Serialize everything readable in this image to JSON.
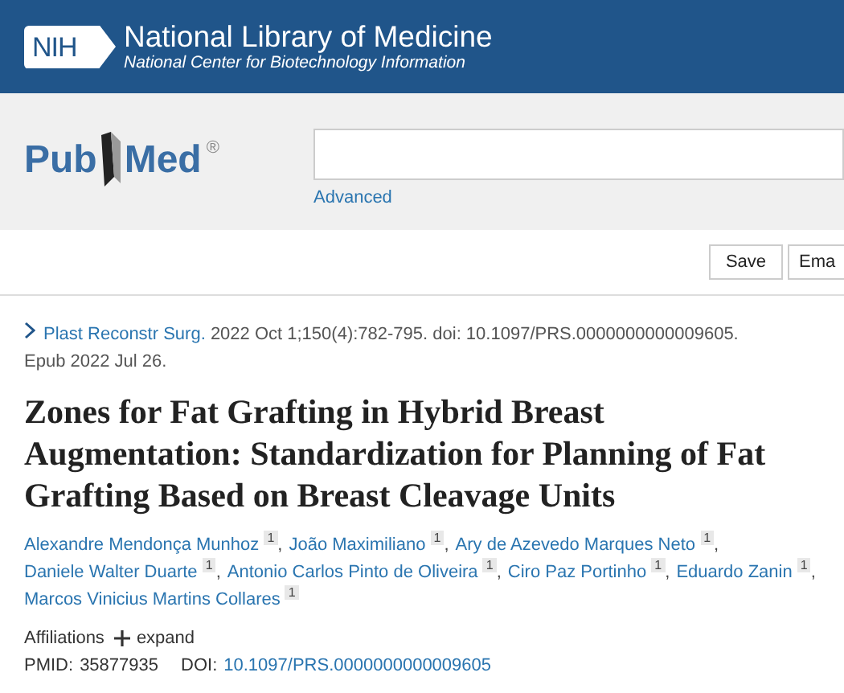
{
  "header": {
    "badge": "NIH",
    "title": "National Library of Medicine",
    "subtitle": "National Center for Biotechnology Information"
  },
  "search": {
    "logo": {
      "left": "Pub",
      "right": "Med",
      "mark": "®"
    },
    "advanced": "Advanced"
  },
  "toolbar": {
    "buttons": [
      "Save",
      "Ema"
    ]
  },
  "citation": {
    "journal": "Plast Reconstr Surg.",
    "details": "2022 Oct 1;150(4):782-795. doi: 10.1097/PRS.0000000000009605.",
    "epub": "Epub 2022 Jul 26."
  },
  "title": "Zones for Fat Grafting in Hybrid Breast Augmentation: Standardization for Planning of Fat Grafting Based on Breast Cleavage Units",
  "author_separator": ",",
  "authors": [
    {
      "name": "Alexandre Mendonça Munhoz",
      "ref": "1"
    },
    {
      "name": "João Maximiliano",
      "ref": "1"
    },
    {
      "name": "Ary de Azevedo Marques Neto",
      "ref": "1"
    },
    {
      "name": "Daniele Walter Duarte",
      "ref": "1"
    },
    {
      "name": "Antonio Carlos Pinto de Oliveira",
      "ref": "1"
    },
    {
      "name": "Ciro Paz Portinho",
      "ref": "1"
    },
    {
      "name": "Eduardo Zanin",
      "ref": "1"
    },
    {
      "name": "Marcos Vinicius Martins Collares",
      "ref": "1"
    }
  ],
  "affiliations": {
    "label": "Affiliations",
    "toggle": "expand",
    "expanded": false
  },
  "ids": {
    "pmid_label": "PMID:",
    "pmid": "35877935",
    "doi_label": "DOI:",
    "doi": "10.1097/PRS.0000000000009605"
  }
}
